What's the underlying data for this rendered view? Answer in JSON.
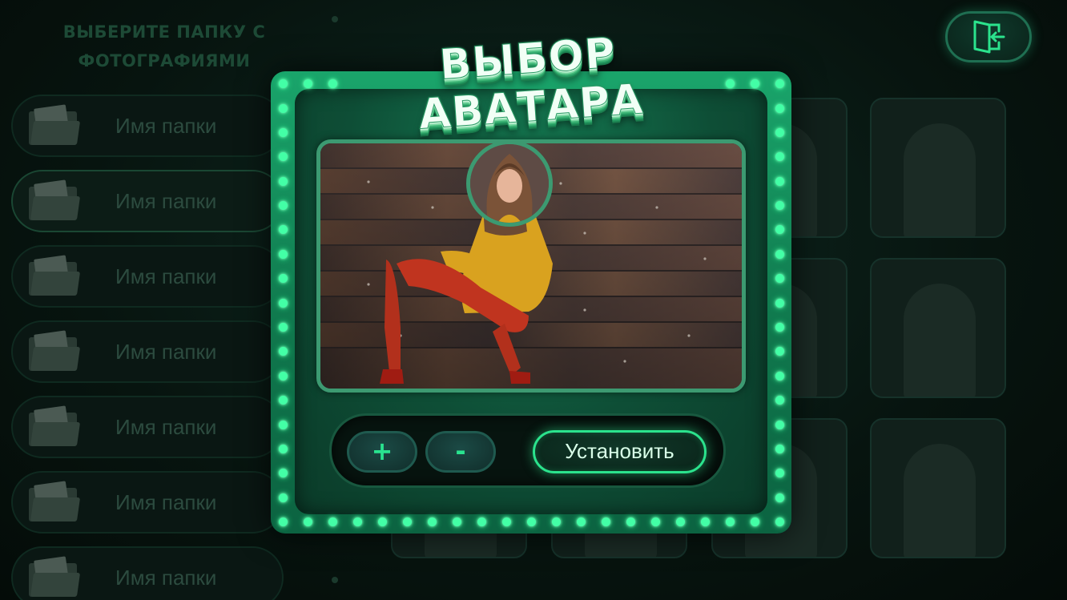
{
  "background": {
    "folders_title": "ВЫБЕРИТЕ ПАПКУ С ФОТОГРАФИЯМИ",
    "folders": [
      {
        "label": "Имя папки"
      },
      {
        "label": "Имя папки"
      },
      {
        "label": "Имя папки"
      },
      {
        "label": "Имя папки"
      },
      {
        "label": "Имя папки"
      },
      {
        "label": "Имя папки"
      },
      {
        "label": "Имя папки"
      }
    ],
    "exit_icon": "exit-door-icon"
  },
  "modal": {
    "title": "ВЫБОР АВАТАРА",
    "zoom_in_label": "+",
    "zoom_out_label": "-",
    "install_label": "Установить"
  },
  "colors": {
    "accent": "#2be38d",
    "frame": "#1aa56b",
    "bulb": "#43ffa6"
  }
}
